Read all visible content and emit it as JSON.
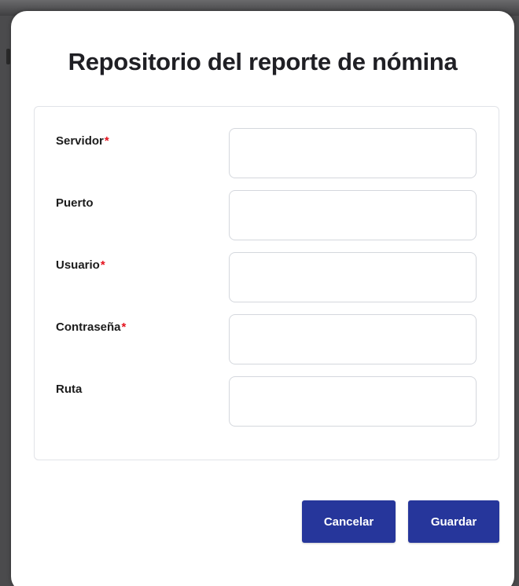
{
  "dialog": {
    "title": "Repositorio del reporte de nómina"
  },
  "form": {
    "required_marker": "*",
    "fields": [
      {
        "label": "Servidor",
        "required": true,
        "value": "",
        "placeholder": ""
      },
      {
        "label": "Puerto",
        "required": false,
        "value": "",
        "placeholder": ""
      },
      {
        "label": "Usuario",
        "required": true,
        "value": "",
        "placeholder": ""
      },
      {
        "label": "Contraseña",
        "required": true,
        "value": "",
        "placeholder": ""
      },
      {
        "label": "Ruta",
        "required": false,
        "value": "",
        "placeholder": ""
      }
    ]
  },
  "actions": {
    "cancel_label": "Cancelar",
    "save_label": "Guardar"
  },
  "colors": {
    "primary_button": "#26369b",
    "required_marker": "#e4121d",
    "backdrop": "#4b4b4d"
  }
}
